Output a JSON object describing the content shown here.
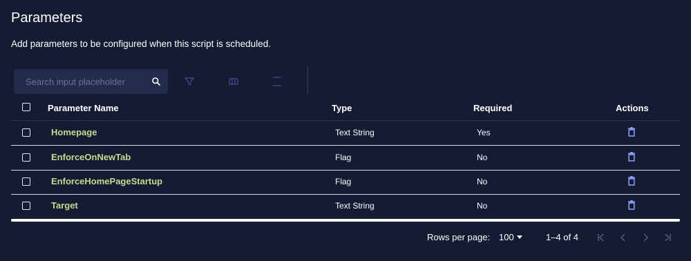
{
  "header": {
    "title": "Parameters",
    "subtitle": "Add parameters to be configured when this script is scheduled."
  },
  "toolbar": {
    "search_placeholder": "Search input placeholder",
    "search_value": "",
    "icons": [
      "search-icon",
      "filter-icon",
      "columns-icon",
      "density-icon"
    ]
  },
  "table": {
    "columns": [
      "Parameter Name",
      "Type",
      "Required",
      "Actions"
    ],
    "rows": [
      {
        "name": "Homepage",
        "type": "Text String",
        "required": "Yes"
      },
      {
        "name": "EnforceOnNewTab",
        "type": "Flag",
        "required": "No"
      },
      {
        "name": "EnforceHomePageStartup",
        "type": "Flag",
        "required": "No"
      },
      {
        "name": "Target",
        "type": "Text String",
        "required": "No"
      }
    ]
  },
  "pagination": {
    "rows_per_page_label": "Rows per page:",
    "rows_per_page_value": "100",
    "range_label": "1–4 of 4"
  },
  "colors": {
    "background": "#141b33",
    "search_bg": "#232c4a",
    "param_name": "#c9d98f",
    "icon_accent": "#8fa3ff"
  }
}
